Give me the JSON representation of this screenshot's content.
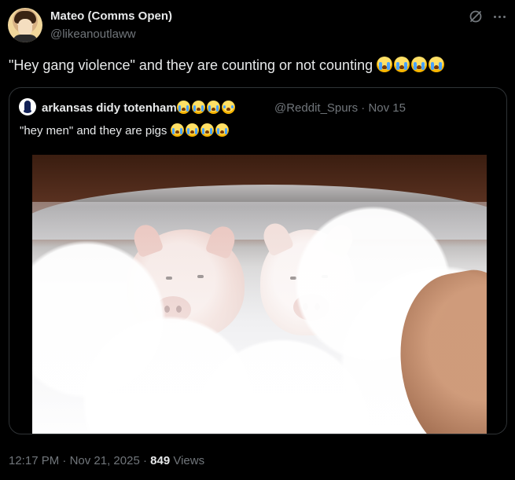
{
  "tweet": {
    "author": {
      "display_name": "Mateo (Comms Open)",
      "handle": "@likeanoutlaww"
    },
    "text": "\"Hey gang violence\" and they are counting or not counting",
    "emoji_after_text": [
      "loudly-crying-face",
      "loudly-crying-face",
      "loudly-crying-face",
      "loudly-crying-face"
    ],
    "quoted": {
      "display_name": "arkansas didy totenham",
      "name_emoji": [
        "loudly-crying-face",
        "loudly-crying-face",
        "loudly-crying-face",
        "crying-face"
      ],
      "handle": "@Reddit_Spurs",
      "separator": "·",
      "date": "Nov 15",
      "text": "\"hey men\" and they are pigs",
      "emoji_after_text": [
        "loudly-crying-face",
        "loudly-crying-face",
        "loudly-crying-face",
        "loudly-crying-face"
      ],
      "media": "two piglets in a bubble bath"
    },
    "footer": {
      "time": "12:17 PM",
      "separator": "·",
      "date": "Nov 21, 2025",
      "separator2": "·",
      "views_count": "849",
      "views_label": "Views"
    }
  },
  "colors": {
    "background": "#000000",
    "text_primary": "#e7e9ea",
    "text_secondary": "#71767b",
    "border": "#2f3336"
  },
  "icons": {
    "grok": "grok-icon",
    "more": "more-icon"
  }
}
